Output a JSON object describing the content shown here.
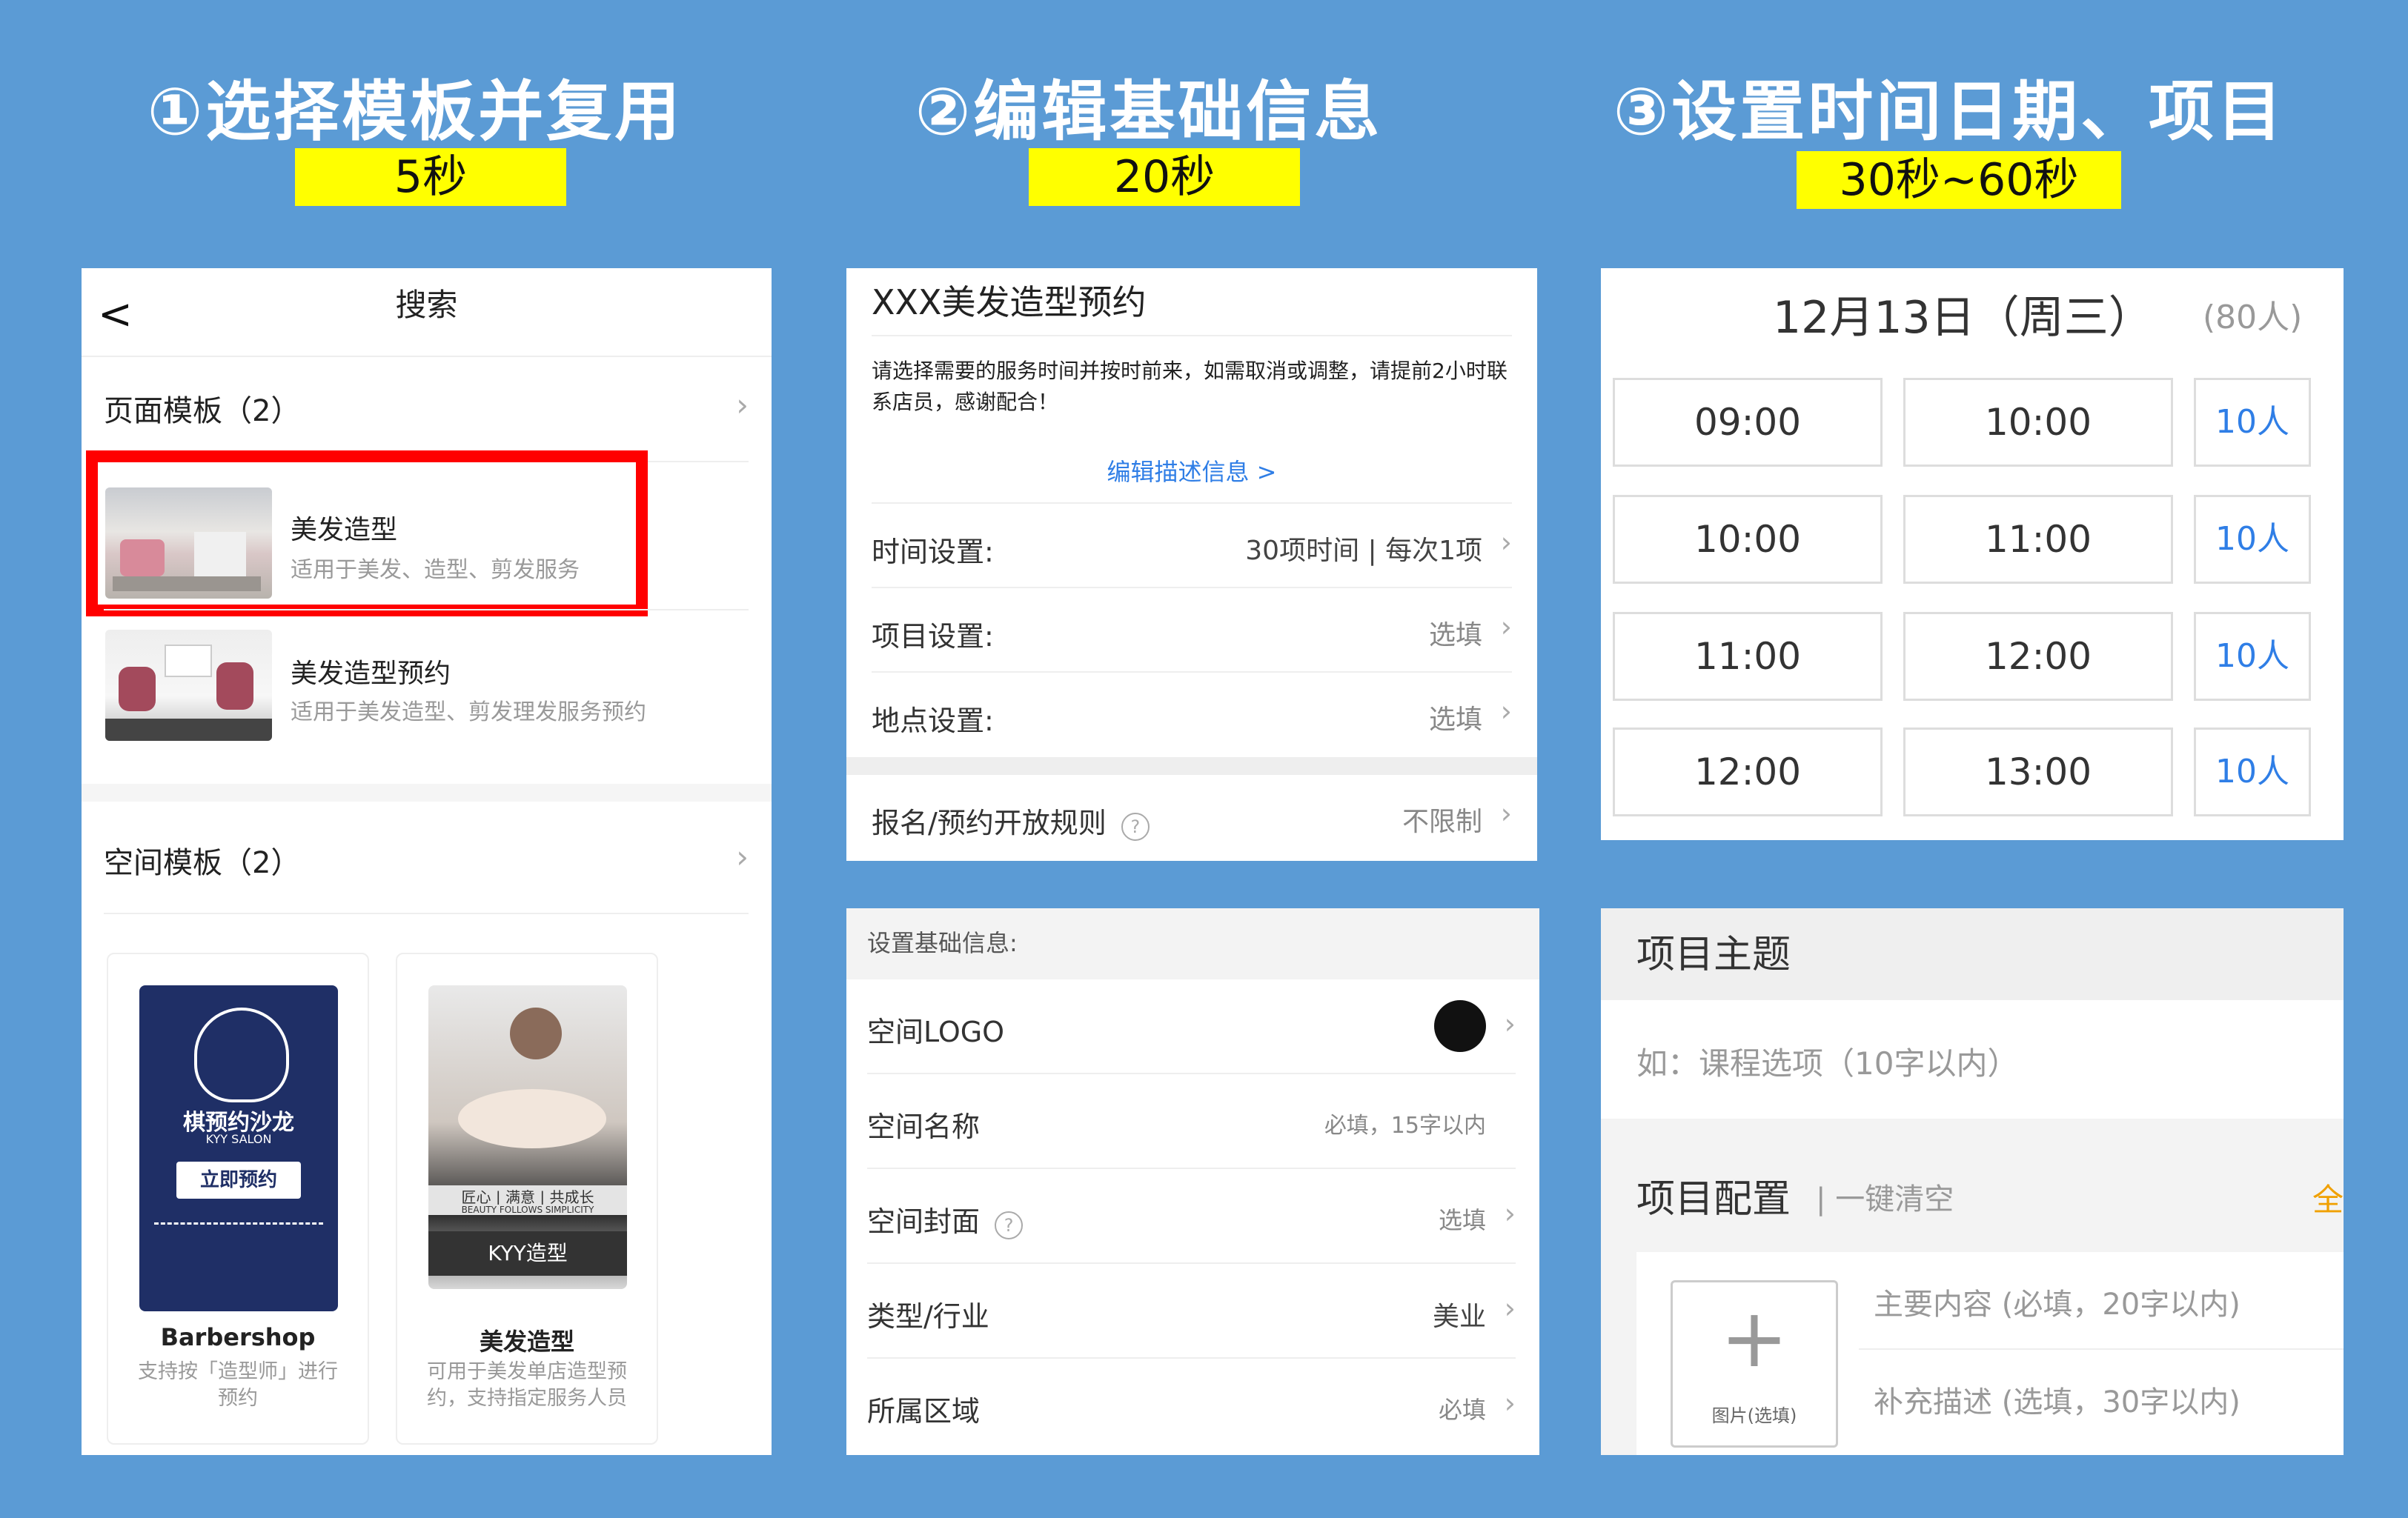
{
  "steps": [
    {
      "title": "①选择模板并复用",
      "time": "5秒"
    },
    {
      "title": "②编辑基础信息",
      "time": "20秒"
    },
    {
      "title": "③设置时间日期、项目",
      "time": "30秒~60秒"
    }
  ],
  "search_panel": {
    "back": "<",
    "title": "搜索",
    "page_templates_label": "页面模板（2）",
    "chevron": "›",
    "templates": [
      {
        "name": "美发造型",
        "desc": "适用于美发、造型、剪发服务"
      },
      {
        "name": "美发造型预约",
        "desc": "适用于美发造型、剪发理发服务预约"
      }
    ],
    "space_templates_label": "空间模板（2）",
    "cards": [
      {
        "name": "Barbershop",
        "desc": "支持按「造型师」进行预约",
        "poster_lines": [
          "棋预约沙龙",
          "KYY SALON",
          "立即预约"
        ]
      },
      {
        "name": "美发造型",
        "desc": "可用于美发单店造型预约，支持指定服务人员",
        "poster_lines": [
          "匠心 | 满意 | 共成长",
          "BEAUTY FOLLOWS SIMPLICITY",
          "KYY造型"
        ]
      }
    ]
  },
  "booking_panel": {
    "title": "XXX美发造型预约",
    "description": "请选择需要的服务时间并按时前来，如需取消或调整，请提前2小时联系店员，感谢配合！",
    "edit_link": "编辑描述信息 >",
    "rows": [
      {
        "label": "时间设置:",
        "value": "30项时间 | 每次1项"
      },
      {
        "label": "项目设置:",
        "value": "选填"
      },
      {
        "label": "地点设置:",
        "value": "选填"
      },
      {
        "label": "报名/预约开放规则",
        "value": "不限制"
      }
    ],
    "help_icon": "?"
  },
  "basic_info_panel": {
    "header": "设置基础信息:",
    "rows": [
      {
        "label": "空间LOGO",
        "value": ""
      },
      {
        "label": "空间名称",
        "value": "必填，15字以内"
      },
      {
        "label": "空间封面",
        "value": "选填"
      },
      {
        "label": "类型/行业",
        "value": "美业"
      },
      {
        "label": "所属区域",
        "value": "必填"
      }
    ],
    "help_icon": "?"
  },
  "schedule_panel": {
    "date": "12月13日（周三）",
    "count": "(80人)",
    "slots": [
      {
        "start": "09:00",
        "end": "10:00",
        "cap": "10人"
      },
      {
        "start": "10:00",
        "end": "11:00",
        "cap": "10人"
      },
      {
        "start": "11:00",
        "end": "12:00",
        "cap": "10人"
      },
      {
        "start": "12:00",
        "end": "13:00",
        "cap": "10人"
      }
    ]
  },
  "project_panel": {
    "theme_title": "项目主题",
    "theme_placeholder": "如：课程选项（10字以内）",
    "config_title": "项目配置",
    "clear_link": "| 一键清空",
    "select_all": "全",
    "image_label": "图片(选填)",
    "plus": "+",
    "main_placeholder": "主要内容 (必填，20字以内)",
    "sub_placeholder": "补充描述 (选填，30字以内)"
  },
  "colors": {
    "background": "#5b9bd5",
    "badge": "#ffff00",
    "highlight": "#ff0000",
    "link": "#2f7ee6",
    "accent": "#ff9900"
  }
}
